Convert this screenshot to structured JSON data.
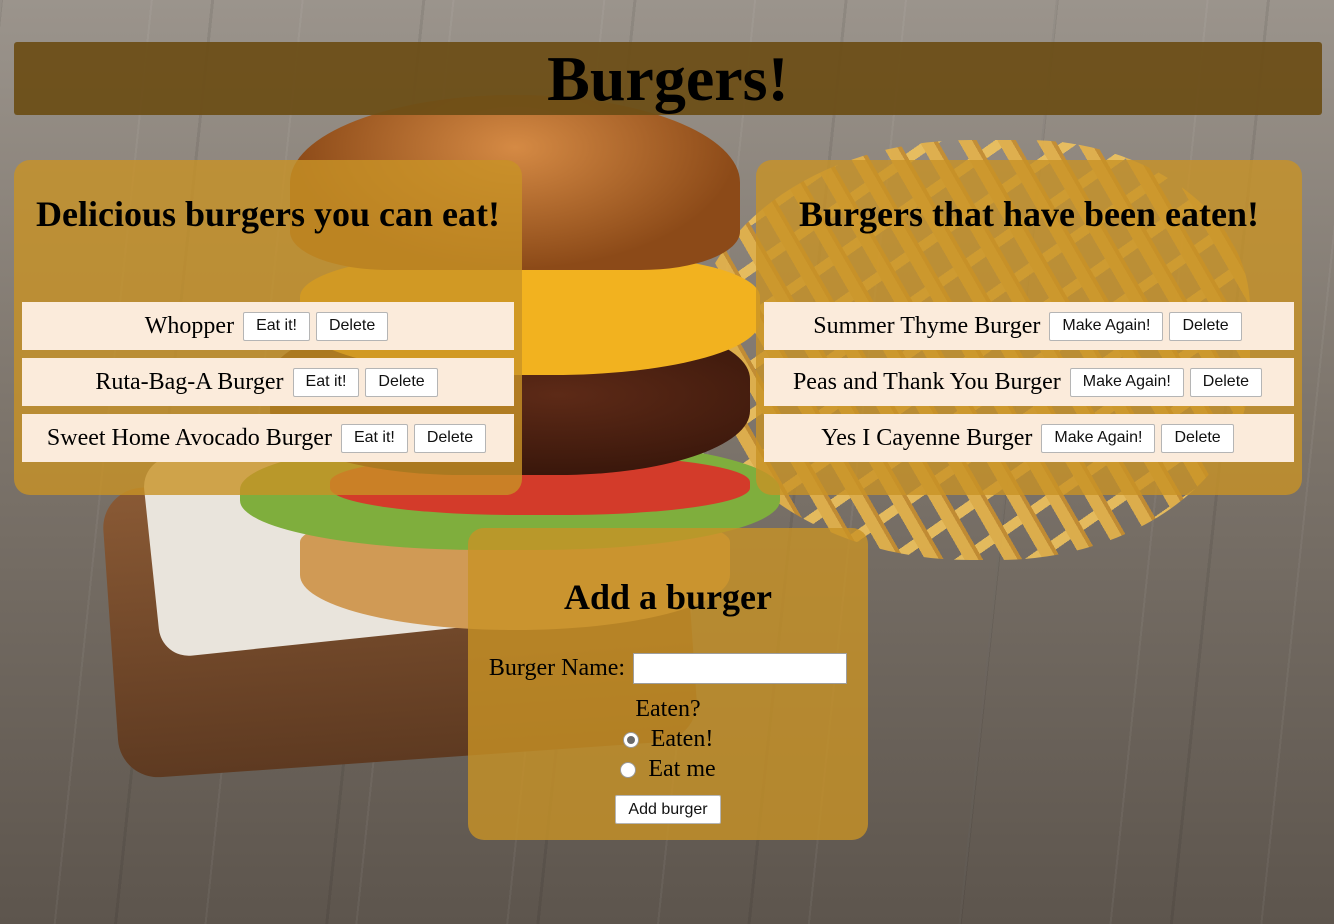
{
  "header": {
    "title": "Burgers!"
  },
  "uneaten": {
    "title": "Delicious burgers you can eat!",
    "items": [
      {
        "name": "Whopper",
        "action_label": "Eat it!",
        "delete_label": "Delete"
      },
      {
        "name": "Ruta-Bag-A Burger",
        "action_label": "Eat it!",
        "delete_label": "Delete"
      },
      {
        "name": "Sweet Home Avocado Burger",
        "action_label": "Eat it!",
        "delete_label": "Delete"
      }
    ]
  },
  "eaten": {
    "title": "Burgers that have been eaten!",
    "items": [
      {
        "name": "Summer Thyme Burger",
        "action_label": "Make Again!",
        "delete_label": "Delete"
      },
      {
        "name": "Peas and Thank You Burger",
        "action_label": "Make Again!",
        "delete_label": "Delete"
      },
      {
        "name": "Yes I Cayenne Burger",
        "action_label": "Make Again!",
        "delete_label": "Delete"
      }
    ]
  },
  "form": {
    "title": "Add a burger",
    "name_label": "Burger Name:",
    "name_value": "",
    "eaten_question": "Eaten?",
    "options": [
      {
        "label": "Eaten!",
        "checked": true
      },
      {
        "label": "Eat me",
        "checked": false
      }
    ],
    "submit_label": "Add burger"
  },
  "colors": {
    "header_bg": "#6c4e16",
    "panel_bg": "#c89226",
    "item_bg": "#fbebdb"
  }
}
